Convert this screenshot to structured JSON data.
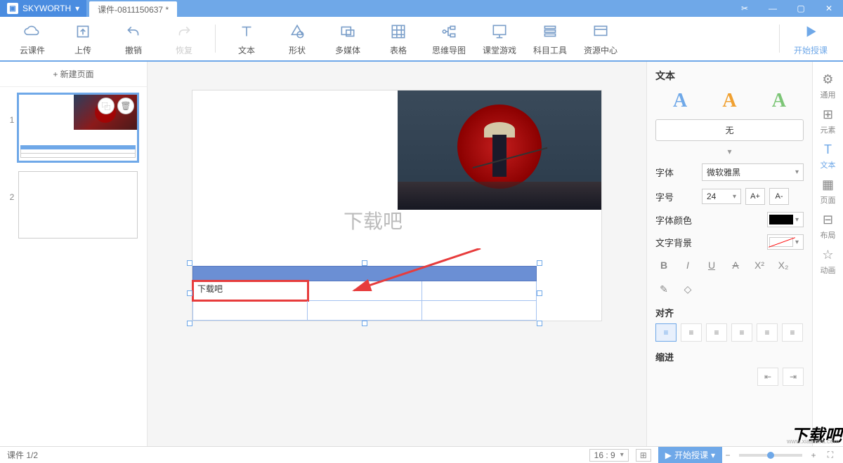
{
  "title": {
    "brand": "SKYWORTH",
    "doc": "课件-0811150637 *"
  },
  "ribbon": {
    "cloud": "云课件",
    "upload": "上传",
    "undo": "撤销",
    "redo": "恢复",
    "text": "文本",
    "shape": "形状",
    "media": "多媒体",
    "table": "表格",
    "mind": "思维导图",
    "game": "课堂游戏",
    "subject": "科目工具",
    "resource": "资源中心",
    "start": "开始授课"
  },
  "slides": {
    "newPage": "+ 新建页面",
    "nums": [
      "1",
      "2"
    ]
  },
  "canvas": {
    "placeholder": "下载吧",
    "cellText": "下载吧"
  },
  "props": {
    "title": "文本",
    "none": "无",
    "font": "字体",
    "fontVal": "微软雅黑",
    "size": "字号",
    "sizeVal": "24",
    "bigger": "A+",
    "smaller": "A-",
    "color": "字体颜色",
    "bg": "文字背景",
    "align": "对齐",
    "indent": "缩进"
  },
  "sidetabs": {
    "general": "通用",
    "element": "元素",
    "text": "文本",
    "page": "页面",
    "layout": "布局",
    "anim": "动画"
  },
  "status": {
    "page": "课件 1/2",
    "ratio": "16 : 9",
    "play": "开始授课"
  },
  "watermark": "下载吧",
  "watermarkUrl": "www.xiazaiba.com"
}
